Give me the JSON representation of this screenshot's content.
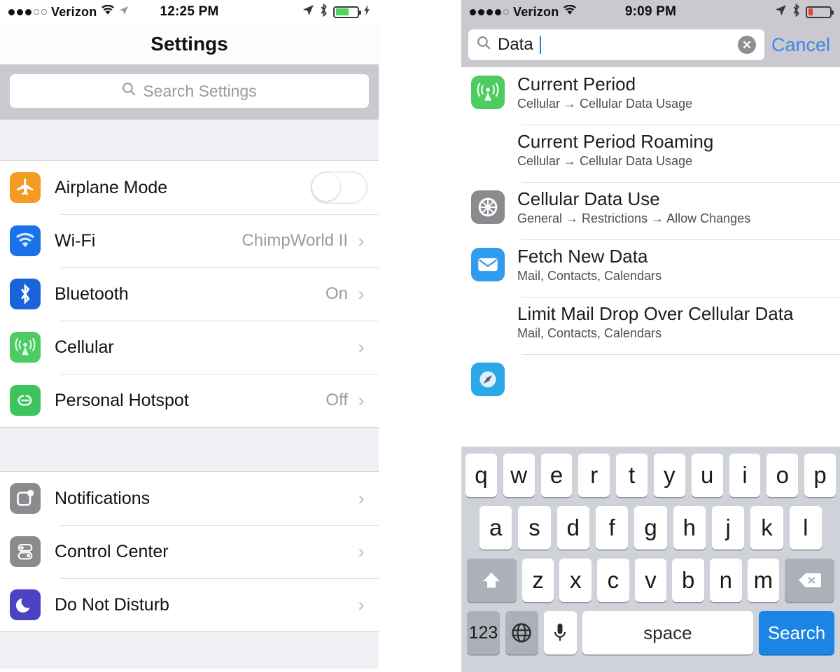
{
  "left_phone": {
    "status_bar": {
      "carrier": "Verizon",
      "signal_dots_filled": 3,
      "signal_dots_total": 5,
      "wifi_icon": "wifi-icon",
      "time": "12:25 PM",
      "location_icon": "location-arrow-icon",
      "bluetooth_icon": "bluetooth-icon",
      "battery_icon": "battery-icon",
      "battery_color": "#4cd35f",
      "charging_icon": "lightning-bolt-icon"
    },
    "nav": {
      "title": "Settings"
    },
    "search": {
      "placeholder": "Search Settings",
      "icon": "search-icon"
    },
    "groups": [
      {
        "rows": [
          {
            "label": "Airplane Mode",
            "icon": "airplane-icon",
            "icon_color": "#f59a23",
            "control": "toggle",
            "toggle_on": false
          },
          {
            "label": "Wi-Fi",
            "icon": "wifi-icon",
            "icon_color": "#1a72e8",
            "value": "ChimpWorld II",
            "control": "chevron"
          },
          {
            "label": "Bluetooth",
            "icon": "bluetooth-icon",
            "icon_color": "#1a63d8",
            "value": "On",
            "control": "chevron"
          },
          {
            "label": "Cellular",
            "icon": "cellular-antenna-icon",
            "icon_color": "#4ccc63",
            "value": "",
            "control": "chevron"
          },
          {
            "label": "Personal Hotspot",
            "icon": "hotspot-link-icon",
            "icon_color": "#3ec45c",
            "value": "Off",
            "control": "chevron"
          }
        ]
      },
      {
        "rows": [
          {
            "label": "Notifications",
            "icon": "notifications-icon",
            "icon_color": "#8a8a8f",
            "value": "",
            "control": "chevron"
          },
          {
            "label": "Control Center",
            "icon": "control-center-icon",
            "icon_color": "#8a8a8f",
            "value": "",
            "control": "chevron"
          },
          {
            "label": "Do Not Disturb",
            "icon": "moon-icon",
            "icon_color": "#4b43c4",
            "value": "",
            "control": "chevron"
          }
        ]
      }
    ]
  },
  "right_phone": {
    "status_bar": {
      "carrier": "Verizon",
      "signal_dots_filled": 4,
      "signal_dots_total": 5,
      "wifi_icon": "wifi-icon",
      "time": "9:09 PM",
      "location_icon": "location-arrow-icon",
      "bluetooth_icon": "bluetooth-icon",
      "battery_icon": "battery-icon",
      "battery_color": "#e8402f"
    },
    "search": {
      "icon": "search-icon",
      "value": "Data",
      "clear_label": "✕",
      "cancel_label": "Cancel"
    },
    "results": [
      {
        "title": "Current Period",
        "subtitle": "Cellular → Cellular Data Usage",
        "icon": "cellular-antenna-icon",
        "icon_color": "#4ccc63"
      },
      {
        "title": "Current Period Roaming",
        "subtitle": "Cellular → Cellular Data Usage",
        "icon": "",
        "icon_color": ""
      },
      {
        "title": "Cellular Data Use",
        "subtitle": "General → Restrictions → Allow Changes",
        "icon": "gear-icon",
        "icon_color": "#8a8a8f"
      },
      {
        "title": "Fetch New Data",
        "subtitle": "Mail, Contacts, Calendars",
        "icon": "mail-envelope-icon",
        "icon_color": "#2f9cf0"
      },
      {
        "title": "Limit Mail Drop Over Cellular Data",
        "subtitle": "Mail, Contacts, Calendars",
        "icon": "",
        "icon_color": ""
      },
      {
        "title": "",
        "subtitle": "",
        "icon": "safari-compass-icon",
        "icon_color": "#2aa8e8"
      }
    ],
    "keyboard": {
      "row1": [
        "q",
        "w",
        "e",
        "r",
        "t",
        "y",
        "u",
        "i",
        "o",
        "p"
      ],
      "row2": [
        "a",
        "s",
        "d",
        "f",
        "g",
        "h",
        "j",
        "k",
        "l"
      ],
      "row3": [
        "z",
        "x",
        "c",
        "v",
        "b",
        "n",
        "m"
      ],
      "shift_label": "shift-key",
      "backspace_label": "backspace-key",
      "numbers_label": "123",
      "globe_label": "globe-key",
      "mic_label": "microphone-key",
      "space_label": "space",
      "search_label": "Search"
    }
  }
}
